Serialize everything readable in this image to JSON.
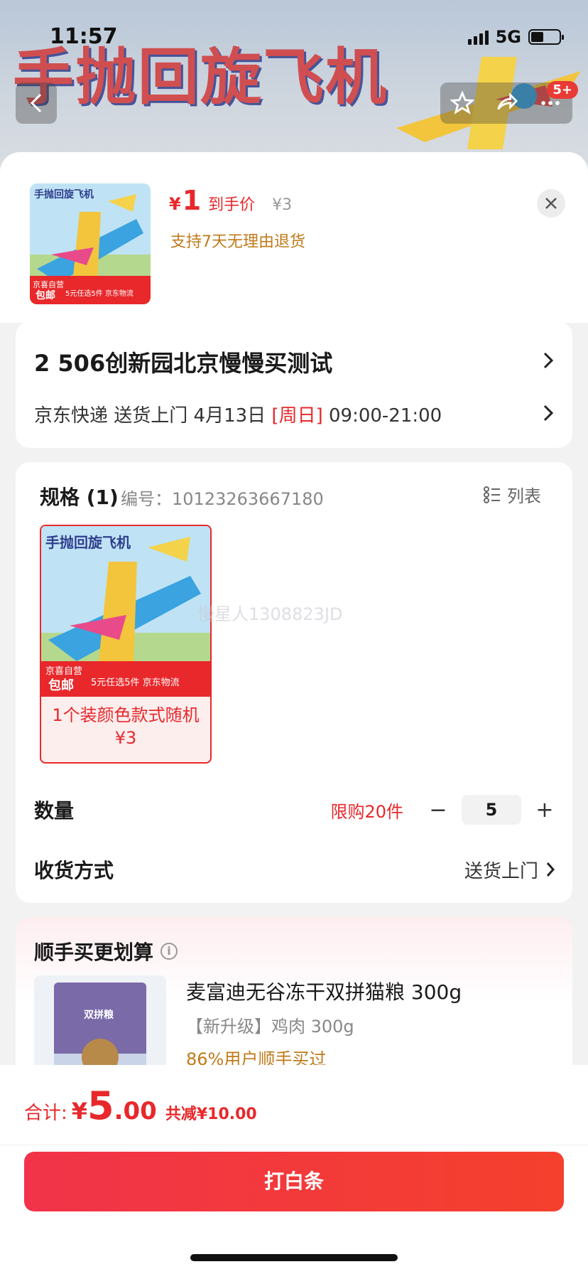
{
  "status_bar": {
    "time": "11:57",
    "network": "5G"
  },
  "background": {
    "title": "手抛回旋飞机",
    "badge": "5+"
  },
  "sheet": {
    "price_symbol": "¥",
    "price": "1",
    "price_tag": "到手价",
    "original_price": "¥3",
    "return_policy": "支持7天无理由退货"
  },
  "thumb": {
    "title": "手抛回旋飞机",
    "tag_line1": "京喜自营",
    "tag_line2": "包邮",
    "banner": "5元任选5件 京东物流"
  },
  "address": {
    "main": "2 506创新园北京慢慢买测试",
    "delivery_prefix": "京东快递 送货上门 4月13日 ",
    "delivery_day": "[周日]",
    "delivery_time": " 09:00-21:00"
  },
  "spec": {
    "title": "规格 (1)",
    "code": "编号：10123263667180",
    "list_label": "列表",
    "item_label": "1个装颜色款式随机",
    "item_price": "¥3",
    "watermark": "慢星人1308823JD"
  },
  "quantity": {
    "label": "数量",
    "limit": "限购20件",
    "minus": "−",
    "plus": "+",
    "value": "5"
  },
  "shipping": {
    "label": "收货方式",
    "value": "送货上门"
  },
  "recommend": {
    "title": "顺手买更划算",
    "product_name": "麦富迪无谷冻干双拼猫粮 300g",
    "product_spec": "【新升级】鸡肉 300g",
    "bought": "86%用户顺手买过",
    "image_text": "双拼粮"
  },
  "footer": {
    "total_label": "合计:",
    "yen": "¥",
    "amount_int": "5",
    "amount_dec": ".00",
    "savings": "共减¥10.00",
    "pay_button": "打白条"
  },
  "colors": {
    "accent": "#e8282b",
    "gold": "#c07a1a",
    "button": "#f2334a"
  }
}
